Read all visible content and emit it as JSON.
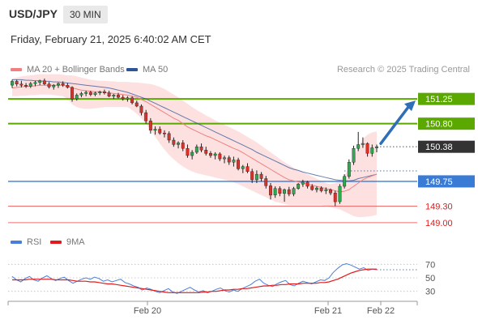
{
  "header": {
    "symbol": "USD/JPY",
    "timeframe": "30 MIN"
  },
  "date_line": "Friday, February 21, 2025 6:40:02 AM CET",
  "legend": {
    "bb_label": "MA 20 + Bollinger Bands",
    "bb_color": "#f08080",
    "ma50_label": "MA 50",
    "ma50_color": "#2e5597",
    "credit": "Research © 2025 Trading Central"
  },
  "rsi_legend": {
    "rsi_label": "RSI",
    "rsi_color": "#4a7fd8",
    "ma9_label": "9MA",
    "ma9_color": "#e11b1b"
  },
  "colors": {
    "bull": "#2fa84f",
    "bear": "#d9322b",
    "support": "#3a7bd5",
    "resistance": "#5aa800",
    "pivot": "#333333",
    "target": "#ee6e6e"
  },
  "chart_data": [
    {
      "type": "candlestick",
      "title": "USD/JPY",
      "x_ticks": [
        "Feb 20",
        "Feb 21",
        "Feb 22"
      ],
      "ylim": [
        148.85,
        151.65
      ],
      "grid": false,
      "legend_position": "top-left",
      "levels": [
        {
          "label": "151.25",
          "value": 151.25,
          "kind": "resistance"
        },
        {
          "label": "150.80",
          "value": 150.8,
          "kind": "resistance"
        },
        {
          "label": "150.38",
          "value": 150.38,
          "kind": "pivot"
        },
        {
          "label": "149.75",
          "value": 149.75,
          "kind": "support"
        },
        {
          "label": "149.30",
          "value": 149.3,
          "kind": "target"
        },
        {
          "label": "149.00",
          "value": 149.0,
          "kind": "target"
        }
      ],
      "candles": [
        {
          "o": 151.5,
          "h": 151.6,
          "l": 151.45,
          "c": 151.57
        },
        {
          "o": 151.57,
          "h": 151.6,
          "l": 151.48,
          "c": 151.52
        },
        {
          "o": 151.52,
          "h": 151.58,
          "l": 151.46,
          "c": 151.5
        },
        {
          "o": 151.5,
          "h": 151.54,
          "l": 151.45,
          "c": 151.48
        },
        {
          "o": 151.48,
          "h": 151.56,
          "l": 151.45,
          "c": 151.53
        },
        {
          "o": 151.53,
          "h": 151.58,
          "l": 151.48,
          "c": 151.55
        },
        {
          "o": 151.55,
          "h": 151.6,
          "l": 151.5,
          "c": 151.58
        },
        {
          "o": 151.58,
          "h": 151.62,
          "l": 151.5,
          "c": 151.52
        },
        {
          "o": 151.52,
          "h": 151.56,
          "l": 151.44,
          "c": 151.47
        },
        {
          "o": 151.47,
          "h": 151.52,
          "l": 151.42,
          "c": 151.5
        },
        {
          "o": 151.5,
          "h": 151.55,
          "l": 151.45,
          "c": 151.53
        },
        {
          "o": 151.53,
          "h": 151.57,
          "l": 151.47,
          "c": 151.5
        },
        {
          "o": 151.5,
          "h": 151.54,
          "l": 151.44,
          "c": 151.46
        },
        {
          "o": 151.46,
          "h": 151.48,
          "l": 151.2,
          "c": 151.25
        },
        {
          "o": 151.25,
          "h": 151.35,
          "l": 151.22,
          "c": 151.32
        },
        {
          "o": 151.32,
          "h": 151.38,
          "l": 151.28,
          "c": 151.35
        },
        {
          "o": 151.35,
          "h": 151.4,
          "l": 151.3,
          "c": 151.37
        },
        {
          "o": 151.37,
          "h": 151.4,
          "l": 151.3,
          "c": 151.33
        },
        {
          "o": 151.33,
          "h": 151.38,
          "l": 151.3,
          "c": 151.36
        },
        {
          "o": 151.36,
          "h": 151.4,
          "l": 151.32,
          "c": 151.38
        },
        {
          "o": 151.38,
          "h": 151.42,
          "l": 151.33,
          "c": 151.36
        },
        {
          "o": 151.36,
          "h": 151.4,
          "l": 151.28,
          "c": 151.3
        },
        {
          "o": 151.3,
          "h": 151.34,
          "l": 151.25,
          "c": 151.32
        },
        {
          "o": 151.32,
          "h": 151.36,
          "l": 151.26,
          "c": 151.28
        },
        {
          "o": 151.28,
          "h": 151.32,
          "l": 151.22,
          "c": 151.25
        },
        {
          "o": 151.25,
          "h": 151.3,
          "l": 151.2,
          "c": 151.27
        },
        {
          "o": 151.27,
          "h": 151.3,
          "l": 151.15,
          "c": 151.18
        },
        {
          "o": 151.18,
          "h": 151.22,
          "l": 151.1,
          "c": 151.12
        },
        {
          "o": 151.12,
          "h": 151.15,
          "l": 150.95,
          "c": 151.0
        },
        {
          "o": 151.0,
          "h": 151.05,
          "l": 150.8,
          "c": 150.85
        },
        {
          "o": 150.85,
          "h": 150.9,
          "l": 150.62,
          "c": 150.68
        },
        {
          "o": 150.68,
          "h": 150.75,
          "l": 150.6,
          "c": 150.7
        },
        {
          "o": 150.7,
          "h": 150.75,
          "l": 150.6,
          "c": 150.63
        },
        {
          "o": 150.63,
          "h": 150.68,
          "l": 150.55,
          "c": 150.62
        },
        {
          "o": 150.62,
          "h": 150.66,
          "l": 150.45,
          "c": 150.5
        },
        {
          "o": 150.5,
          "h": 150.55,
          "l": 150.38,
          "c": 150.42
        },
        {
          "o": 150.42,
          "h": 150.48,
          "l": 150.35,
          "c": 150.45
        },
        {
          "o": 150.45,
          "h": 150.5,
          "l": 150.3,
          "c": 150.35
        },
        {
          "o": 150.35,
          "h": 150.42,
          "l": 150.18,
          "c": 150.22
        },
        {
          "o": 150.22,
          "h": 150.32,
          "l": 150.15,
          "c": 150.28
        },
        {
          "o": 150.28,
          "h": 150.42,
          "l": 150.25,
          "c": 150.38
        },
        {
          "o": 150.38,
          "h": 150.44,
          "l": 150.28,
          "c": 150.32
        },
        {
          "o": 150.32,
          "h": 150.38,
          "l": 150.22,
          "c": 150.26
        },
        {
          "o": 150.26,
          "h": 150.3,
          "l": 150.18,
          "c": 150.22
        },
        {
          "o": 150.22,
          "h": 150.28,
          "l": 150.15,
          "c": 150.25
        },
        {
          "o": 150.25,
          "h": 150.28,
          "l": 150.12,
          "c": 150.16
        },
        {
          "o": 150.16,
          "h": 150.22,
          "l": 150.08,
          "c": 150.18
        },
        {
          "o": 150.18,
          "h": 150.22,
          "l": 150.05,
          "c": 150.1
        },
        {
          "o": 150.1,
          "h": 150.2,
          "l": 150.02,
          "c": 150.14
        },
        {
          "o": 150.14,
          "h": 150.18,
          "l": 149.95,
          "c": 149.98
        },
        {
          "o": 149.98,
          "h": 150.05,
          "l": 149.9,
          "c": 150.02
        },
        {
          "o": 150.02,
          "h": 150.08,
          "l": 149.9,
          "c": 149.93
        },
        {
          "o": 149.93,
          "h": 149.98,
          "l": 149.72,
          "c": 149.78
        },
        {
          "o": 149.78,
          "h": 149.95,
          "l": 149.72,
          "c": 149.88
        },
        {
          "o": 149.88,
          "h": 149.92,
          "l": 149.75,
          "c": 149.8
        },
        {
          "o": 149.8,
          "h": 149.85,
          "l": 149.62,
          "c": 149.67
        },
        {
          "o": 149.67,
          "h": 149.72,
          "l": 149.42,
          "c": 149.5
        },
        {
          "o": 149.5,
          "h": 149.66,
          "l": 149.45,
          "c": 149.62
        },
        {
          "o": 149.62,
          "h": 149.66,
          "l": 149.48,
          "c": 149.53
        },
        {
          "o": 149.53,
          "h": 149.62,
          "l": 149.38,
          "c": 149.6
        },
        {
          "o": 149.6,
          "h": 149.65,
          "l": 149.48,
          "c": 149.52
        },
        {
          "o": 149.52,
          "h": 149.65,
          "l": 149.48,
          "c": 149.62
        },
        {
          "o": 149.62,
          "h": 149.72,
          "l": 149.6,
          "c": 149.7
        },
        {
          "o": 149.7,
          "h": 149.78,
          "l": 149.65,
          "c": 149.74
        },
        {
          "o": 149.74,
          "h": 149.76,
          "l": 149.62,
          "c": 149.66
        },
        {
          "o": 149.66,
          "h": 149.7,
          "l": 149.58,
          "c": 149.6
        },
        {
          "o": 149.6,
          "h": 149.66,
          "l": 149.55,
          "c": 149.63
        },
        {
          "o": 149.63,
          "h": 149.66,
          "l": 149.55,
          "c": 149.58
        },
        {
          "o": 149.58,
          "h": 149.64,
          "l": 149.52,
          "c": 149.6
        },
        {
          "o": 149.6,
          "h": 149.62,
          "l": 149.5,
          "c": 149.54
        },
        {
          "o": 149.54,
          "h": 149.58,
          "l": 149.3,
          "c": 149.38
        },
        {
          "o": 149.38,
          "h": 149.7,
          "l": 149.34,
          "c": 149.66
        },
        {
          "o": 149.66,
          "h": 149.88,
          "l": 149.62,
          "c": 149.84
        },
        {
          "o": 149.84,
          "h": 150.15,
          "l": 149.8,
          "c": 150.1
        },
        {
          "o": 150.1,
          "h": 150.4,
          "l": 150.05,
          "c": 150.35
        },
        {
          "o": 150.35,
          "h": 150.65,
          "l": 150.3,
          "c": 150.42
        },
        {
          "o": 150.42,
          "h": 150.55,
          "l": 150.36,
          "c": 150.44
        },
        {
          "o": 150.44,
          "h": 150.46,
          "l": 150.2,
          "c": 150.26
        },
        {
          "o": 150.26,
          "h": 150.42,
          "l": 150.2,
          "c": 150.36
        },
        {
          "o": 150.36,
          "h": 150.42,
          "l": 150.28,
          "c": 150.38
        }
      ],
      "ma20": [
        151.45,
        151.46,
        151.47,
        151.48,
        151.48,
        151.49,
        151.5,
        151.5,
        151.5,
        151.5,
        151.5,
        151.5,
        151.48,
        151.45,
        151.43,
        151.41,
        151.4,
        151.39,
        151.38,
        151.38,
        151.37,
        151.36,
        151.35,
        151.34,
        151.33,
        151.32,
        151.3,
        151.28,
        151.24,
        151.2,
        151.15,
        151.1,
        151.05,
        151.0,
        150.95,
        150.9,
        150.86,
        150.8,
        150.74,
        150.7,
        150.66,
        150.62,
        150.58,
        150.55,
        150.51,
        150.47,
        150.43,
        150.39,
        150.35,
        150.32,
        150.27,
        150.22,
        150.17,
        150.12,
        150.07,
        150.02,
        149.97,
        149.92,
        149.87,
        149.82,
        149.78,
        149.76,
        149.74,
        149.72,
        149.7,
        149.68,
        149.66,
        149.64,
        149.62,
        149.6,
        149.58,
        149.56,
        149.57,
        149.6,
        149.66,
        149.72,
        149.78,
        149.82,
        149.85,
        149.88
      ],
      "ma50": [
        151.6,
        151.6,
        151.6,
        151.59,
        151.59,
        151.58,
        151.58,
        151.57,
        151.57,
        151.56,
        151.56,
        151.55,
        151.54,
        151.53,
        151.52,
        151.51,
        151.5,
        151.49,
        151.48,
        151.47,
        151.46,
        151.45,
        151.43,
        151.41,
        151.39,
        151.37,
        151.34,
        151.31,
        151.28,
        151.25,
        151.21,
        151.17,
        151.13,
        151.09,
        151.05,
        151.01,
        150.97,
        150.93,
        150.89,
        150.85,
        150.81,
        150.77,
        150.73,
        150.69,
        150.65,
        150.61,
        150.57,
        150.53,
        150.49,
        150.45,
        150.41,
        150.37,
        150.33,
        150.28,
        150.24,
        150.2,
        150.16,
        150.12,
        150.08,
        150.04,
        150.0,
        149.97,
        149.95,
        149.92,
        149.9,
        149.88,
        149.86,
        149.84,
        149.82,
        149.8,
        149.78,
        149.77,
        149.76,
        149.76,
        149.77,
        149.8,
        149.82,
        149.84,
        149.86,
        149.88
      ],
      "bb_upper": [
        151.62,
        151.64,
        151.66,
        151.67,
        151.68,
        151.69,
        151.7,
        151.7,
        151.7,
        151.7,
        151.7,
        151.69,
        151.68,
        151.68,
        151.66,
        151.64,
        151.62,
        151.6,
        151.59,
        151.58,
        151.58,
        151.57,
        151.57,
        151.56,
        151.56,
        151.56,
        151.55,
        151.55,
        151.54,
        151.53,
        151.52,
        151.5,
        151.47,
        151.43,
        151.38,
        151.33,
        151.28,
        151.22,
        151.16,
        151.1,
        151.05,
        151.0,
        150.95,
        150.91,
        150.86,
        150.82,
        150.78,
        150.74,
        150.7,
        150.66,
        150.61,
        150.56,
        150.51,
        150.46,
        150.4,
        150.34,
        150.28,
        150.22,
        150.16,
        150.1,
        150.05,
        150.0,
        149.96,
        149.92,
        149.88,
        149.84,
        149.8,
        149.76,
        149.72,
        149.7,
        149.72,
        149.76,
        149.85,
        150.0,
        150.2,
        150.38,
        150.52,
        150.6,
        150.64,
        150.66
      ],
      "bb_lower": [
        151.3,
        151.3,
        151.31,
        151.31,
        151.32,
        151.32,
        151.33,
        151.33,
        151.33,
        151.32,
        151.31,
        151.3,
        151.25,
        151.15,
        151.1,
        151.08,
        151.07,
        151.07,
        151.08,
        151.09,
        151.1,
        151.1,
        151.1,
        151.1,
        151.1,
        151.1,
        151.05,
        150.98,
        150.9,
        150.8,
        150.68,
        150.56,
        150.44,
        150.33,
        150.23,
        150.15,
        150.08,
        150.02,
        149.97,
        149.93,
        149.9,
        149.88,
        149.86,
        149.84,
        149.82,
        149.8,
        149.78,
        149.76,
        149.73,
        149.7,
        149.66,
        149.62,
        149.58,
        149.54,
        149.5,
        149.46,
        149.42,
        149.38,
        149.36,
        149.34,
        149.32,
        149.32,
        149.32,
        149.32,
        149.32,
        149.32,
        149.32,
        149.32,
        149.3,
        149.28,
        149.26,
        149.24,
        149.2,
        149.16,
        149.12,
        149.1,
        149.1,
        149.11,
        149.12,
        149.14
      ],
      "projection": {
        "from": 150.38,
        "to": 151.25
      }
    },
    {
      "type": "line",
      "title": "RSI",
      "x_ticks": [
        "Feb 20",
        "Feb 21",
        "Feb 22"
      ],
      "y_ticks": [
        "70",
        "50",
        "30"
      ],
      "ylim": [
        20,
        80
      ],
      "grid": true,
      "legend_position": "top-left",
      "series": [
        {
          "name": "RSI",
          "values": [
            52,
            47,
            44,
            49,
            52,
            47,
            45,
            50,
            53,
            49,
            46,
            49,
            51,
            46,
            42,
            45,
            48,
            50,
            48,
            51,
            49,
            45,
            47,
            44,
            46,
            48,
            43,
            41,
            38,
            36,
            32,
            35,
            33,
            30,
            28,
            31,
            34,
            29,
            27,
            30,
            33,
            36,
            32,
            29,
            31,
            28,
            30,
            33,
            35,
            31,
            29,
            32,
            30,
            34,
            37,
            40,
            45,
            48,
            42,
            39,
            37,
            41,
            44,
            46,
            40,
            38,
            42,
            45,
            43,
            41,
            44,
            47,
            46,
            50,
            58,
            64,
            69,
            71,
            69,
            66,
            63,
            65,
            61,
            63,
            62
          ]
        },
        {
          "name": "9MA",
          "values": [
            47,
            47,
            47,
            47,
            48,
            48,
            48,
            48,
            48,
            48,
            47,
            47,
            47,
            47,
            46,
            45,
            45,
            45,
            44,
            44,
            43,
            42,
            41,
            41,
            40,
            39,
            38,
            37,
            36,
            35,
            34,
            33,
            32,
            31,
            30,
            29,
            28,
            28,
            28,
            28,
            28,
            28,
            28,
            28,
            29,
            29,
            30,
            30,
            31,
            32,
            32,
            33,
            33,
            34,
            34,
            35,
            36,
            37,
            38,
            38,
            39,
            39,
            40,
            40,
            41,
            41,
            41,
            42,
            42,
            42,
            42,
            43,
            43,
            44,
            46,
            48,
            51,
            54,
            57,
            59,
            61,
            62,
            63,
            63,
            63
          ]
        }
      ]
    }
  ]
}
